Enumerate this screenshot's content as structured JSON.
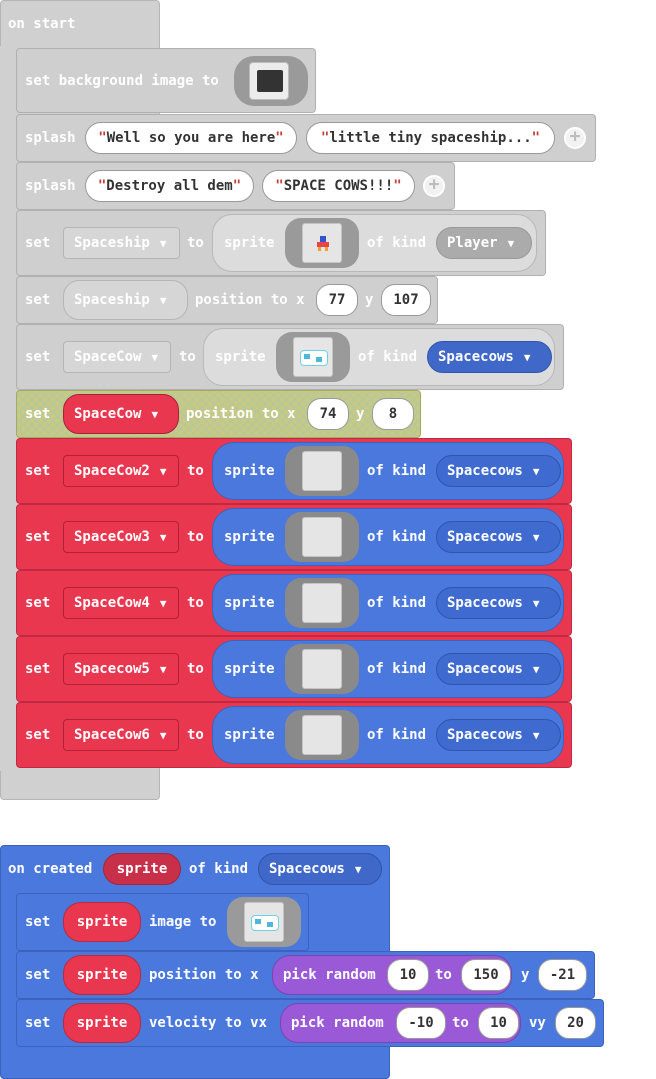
{
  "on_start": {
    "header": "on start",
    "set_bg": {
      "label": "set background image to"
    },
    "splash1": {
      "label": "splash",
      "arg1": "Well so you are here",
      "arg2": "little tiny spaceship..."
    },
    "splash2": {
      "label": "splash",
      "arg1": "Destroy all dem",
      "arg2": "SPACE COWS!!!"
    },
    "set_spaceship": {
      "set": "set",
      "var": "Spaceship",
      "to": "to",
      "sprite": "sprite",
      "of_kind": "of kind",
      "kind": "Player"
    },
    "pos_spaceship": {
      "set": "set",
      "var": "Spaceship",
      "mid": "position to x",
      "x": "77",
      "y_label": "y",
      "y": "107"
    },
    "set_spacecow": {
      "set": "set",
      "var": "SpaceCow",
      "to": "to",
      "sprite": "sprite",
      "of_kind": "of kind",
      "kind": "Spacecows"
    },
    "pos_spacecow": {
      "set": "set",
      "var": "SpaceCow",
      "mid": "position to x",
      "x": "74",
      "y_label": "y",
      "y": "8"
    },
    "cows": [
      {
        "set": "set",
        "var": "SpaceCow2",
        "to": "to",
        "sprite": "sprite",
        "of_kind": "of kind",
        "kind": "Spacecows"
      },
      {
        "set": "set",
        "var": "SpaceCow3",
        "to": "to",
        "sprite": "sprite",
        "of_kind": "of kind",
        "kind": "Spacecows"
      },
      {
        "set": "set",
        "var": "SpaceCow4",
        "to": "to",
        "sprite": "sprite",
        "of_kind": "of kind",
        "kind": "Spacecows"
      },
      {
        "set": "set",
        "var": "Spacecow5",
        "to": "to",
        "sprite": "sprite",
        "of_kind": "of kind",
        "kind": "Spacecows"
      },
      {
        "set": "set",
        "var": "SpaceCow6",
        "to": "to",
        "sprite": "sprite",
        "of_kind": "of kind",
        "kind": "Spacecows"
      }
    ]
  },
  "on_created": {
    "header_prefix": "on created",
    "param": "sprite",
    "of_kind": "of kind",
    "kind": "Spacecows",
    "set_image": {
      "set": "set",
      "var": "sprite",
      "label": "image to"
    },
    "set_pos": {
      "set": "set",
      "var": "sprite",
      "label": "position to x",
      "pick": "pick random",
      "from": "10",
      "to": "to",
      "to_val": "150",
      "y_label": "y",
      "y": "-21"
    },
    "set_vel": {
      "set": "set",
      "var": "sprite",
      "label": "velocity to vx",
      "pick": "pick random",
      "from": "-10",
      "to": "to",
      "to_val": "10",
      "vy_label": "vy",
      "vy": "20"
    }
  },
  "colors": {
    "loops_grey": "#cfcfcf",
    "variables_red": "#e8374f",
    "sprites_blue": "#4a78dd",
    "math_purple": "#9a59d6",
    "highlight": "#c9c981"
  },
  "icons": [
    "add-icon",
    "dropdown-caret-icon",
    "spaceship-sprite-icon",
    "cow-sprite-icon",
    "background-image-icon"
  ]
}
